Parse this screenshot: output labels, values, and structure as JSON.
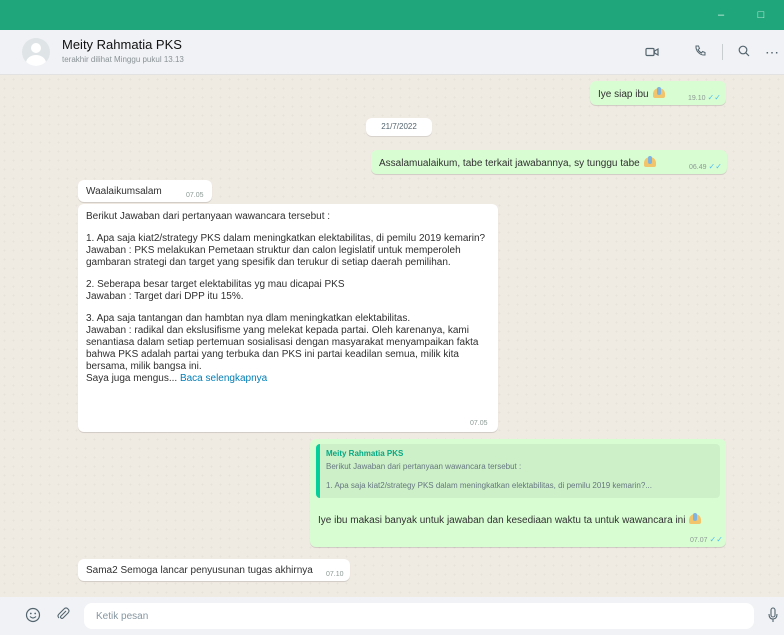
{
  "header": {
    "contact_name": "Meity Rahmatia PKS",
    "contact_status": "terakhir dilihat Minggu pukul 13.13"
  },
  "messages": {
    "m1": {
      "text": "Iye siap ibu",
      "time": "19.10"
    },
    "date_chip": "21/7/2022",
    "m2": {
      "text": "Assalamualaikum, tabe terkait jawabannya, sy tunggu tabe",
      "time": "06.49"
    },
    "m3": {
      "text": "Waalaikumsalam",
      "time": "07.05"
    },
    "m4": {
      "intro": "Berikut Jawaban dari pertanyaan wawancara tersebut :",
      "p1": "1. Apa saja kiat2/strategy PKS dalam meningkatkan elektabilitas, di pemilu 2019 kemarin?\nJawaban : PKS melakukan Pemetaan struktur dan calon legislatif untuk memperoleh gambaran strategi dan target yang spesifik dan terukur di setiap daerah pemilihan.",
      "p2": "2. Seberapa besar target elektabilitas yg mau dicapai PKS\nJawaban : Target dari DPP itu 15%.",
      "p3": "3. Apa saja tantangan dan hambtan nya dlam meningkatkan elektabilitas.\nJawaban : radikal dan ekslusifisme yang melekat kepada partai. Oleh karenanya, kami senantiasa dalam setiap pertemuan sosialisasi dengan masyarakat menyampaikan fakta bahwa PKS adalah partai yang terbuka dan PKS ini partai keadilan semua, milik kita bersama, milik bangsa ini.",
      "p4": "Saya juga mengus...",
      "read_more": "Baca selengkapnya",
      "time": "07.05"
    },
    "m5": {
      "quote_name": "Meity Rahmatia PKS",
      "quote_line1": "Berikut Jawaban dari pertanyaan wawancara tersebut :",
      "quote_line2": "1. Apa saja kiat2/strategy PKS dalam meningkatkan elektabilitas, di pemilu 2019 kemarin?...",
      "text": "Iye ibu makasi banyak untuk jawaban dan kesediaan waktu ta untuk wawancara ini",
      "time": "07.07"
    },
    "m6": {
      "text": "Sama2 Semoga lancar penyusunan tugas akhirnya",
      "time": "07.10"
    }
  },
  "composer": {
    "placeholder": "Ketik pesan"
  },
  "colors": {
    "titlebar": "#1fa67a",
    "outgoing": "#d9fdd3",
    "incoming": "#ffffff",
    "tick": "#53bdeb"
  }
}
